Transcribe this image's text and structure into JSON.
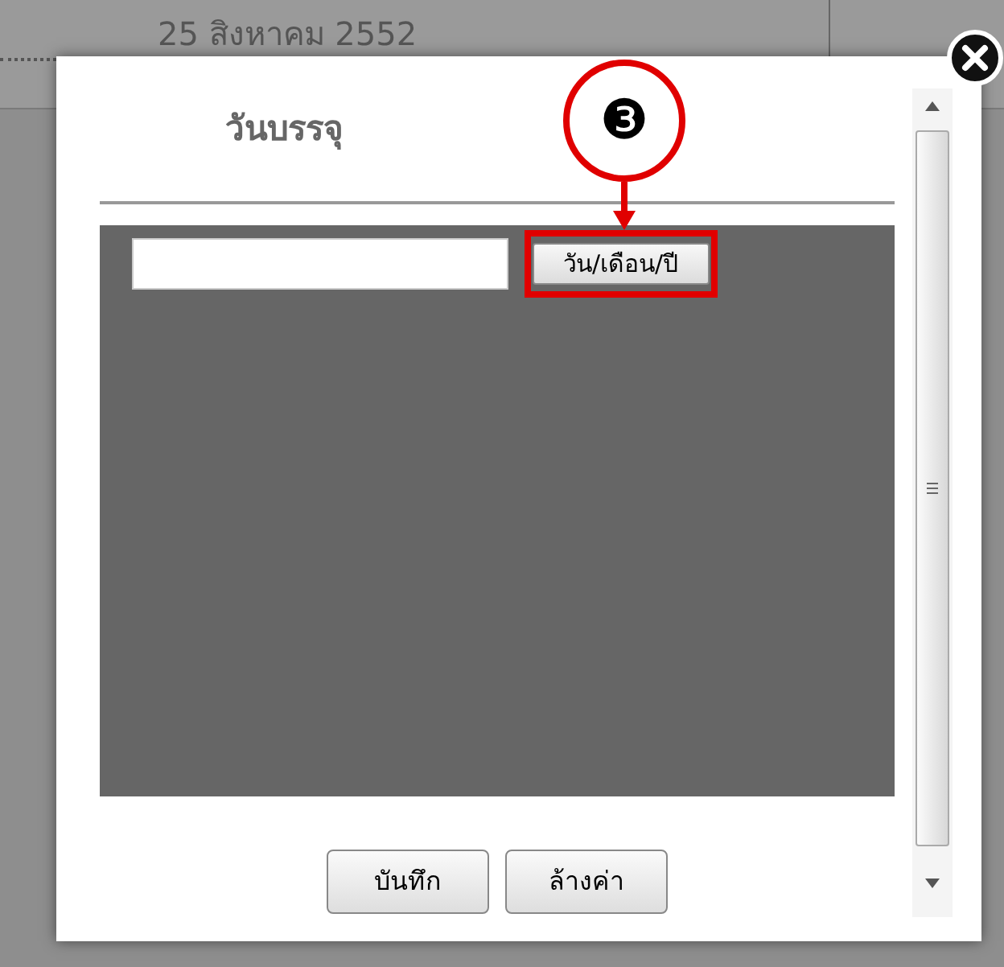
{
  "background": {
    "date_text": "25 สิงหาคม 2552"
  },
  "dialog": {
    "title": "วันบรรจุ",
    "date_button": "วัน/เดือน/ปี",
    "buttons": [
      {
        "label": "บันทึก"
      },
      {
        "label": "ล้างค่า"
      }
    ]
  },
  "annotation": {
    "marker": "❸"
  }
}
